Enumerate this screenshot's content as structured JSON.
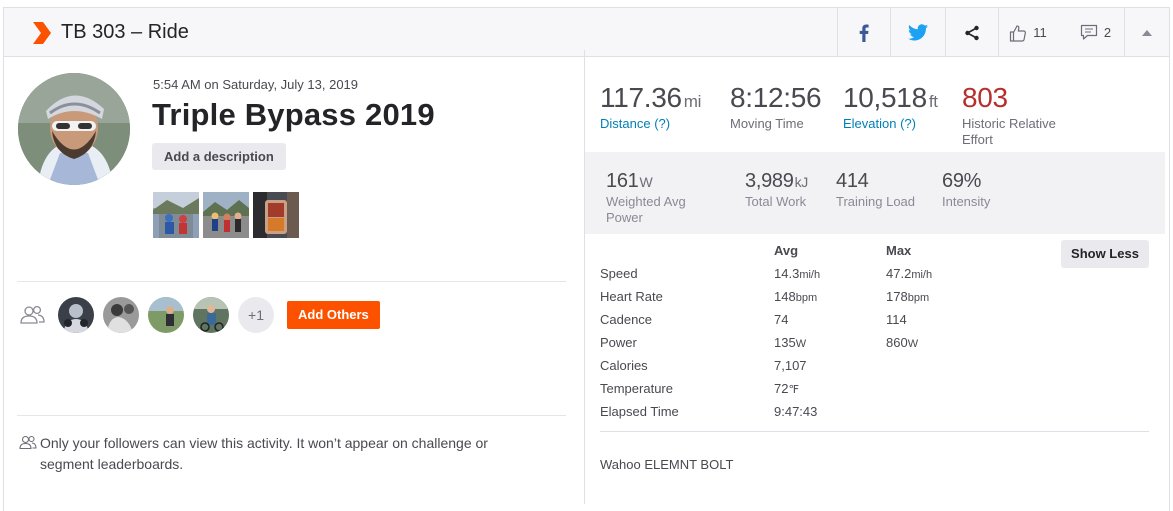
{
  "header": {
    "title": "TB 303 – Ride",
    "kudos_count": "11",
    "comment_count": "2"
  },
  "activity": {
    "date": "5:54 AM on Saturday, July 13, 2019",
    "title": "Triple Bypass 2019",
    "add_description_label": "Add a description",
    "more_athletes_label": "+1",
    "add_others_label": "Add Others",
    "privacy_line1": "Only your followers can view this activity. It won’t appear on challenge or",
    "privacy_line2": "segment leaderboards."
  },
  "primary_stats": [
    {
      "value": "117.36",
      "unit": "mi",
      "label": "Distance (?)"
    },
    {
      "value": "8:12:56",
      "unit": "",
      "label": "Moving Time"
    },
    {
      "value": "10,518",
      "unit": "ft",
      "label": "Elevation (?)"
    },
    {
      "value": "803",
      "unit": "",
      "label_line1": "Historic Relative",
      "label_line2": "Effort"
    }
  ],
  "secondary_stats": [
    {
      "value": "161",
      "unit": "W",
      "label_line1": "Weighted Avg",
      "label_line2": "Power"
    },
    {
      "value": "3,989",
      "unit": "kJ",
      "label": "Total Work"
    },
    {
      "value": "414",
      "unit": "",
      "label": "Training Load"
    },
    {
      "value": "69%",
      "unit": "",
      "label": "Intensity"
    }
  ],
  "table": {
    "avg_header": "Avg",
    "max_header": "Max",
    "show_less_label": "Show Less",
    "rows": [
      {
        "label": "Speed",
        "avg": "14.3",
        "avg_unit": "mi/h",
        "max": "47.2",
        "max_unit": "mi/h"
      },
      {
        "label": "Heart Rate",
        "avg": "148",
        "avg_unit": "bpm",
        "max": "178",
        "max_unit": "bpm"
      },
      {
        "label": "Cadence",
        "avg": "74",
        "avg_unit": "",
        "max": "114",
        "max_unit": ""
      },
      {
        "label": "Power",
        "avg": "135",
        "avg_unit": "W",
        "max": "860",
        "max_unit": "W"
      },
      {
        "label": "Calories",
        "avg": "7,107",
        "avg_unit": "",
        "max": "",
        "max_unit": ""
      },
      {
        "label": "Temperature",
        "avg": "72",
        "avg_unit": "℉",
        "max": "",
        "max_unit": ""
      },
      {
        "label": "Elapsed Time",
        "avg": "9:47:43",
        "avg_unit": "",
        "max": "",
        "max_unit": ""
      }
    ],
    "device": "Wahoo ELEMNT BOLT"
  },
  "colors": {
    "brand_orange": "#fc5200",
    "facebook_blue": "#3b5998",
    "twitter_blue": "#1da1f2",
    "link_blue": "#007fb6",
    "effort_red": "#b5302d"
  },
  "icons": [
    "strava-logo-icon",
    "facebook-icon",
    "twitter-icon",
    "share-icon",
    "thumbs-up-icon",
    "comment-icon",
    "caret-up-icon",
    "people-icon"
  ]
}
